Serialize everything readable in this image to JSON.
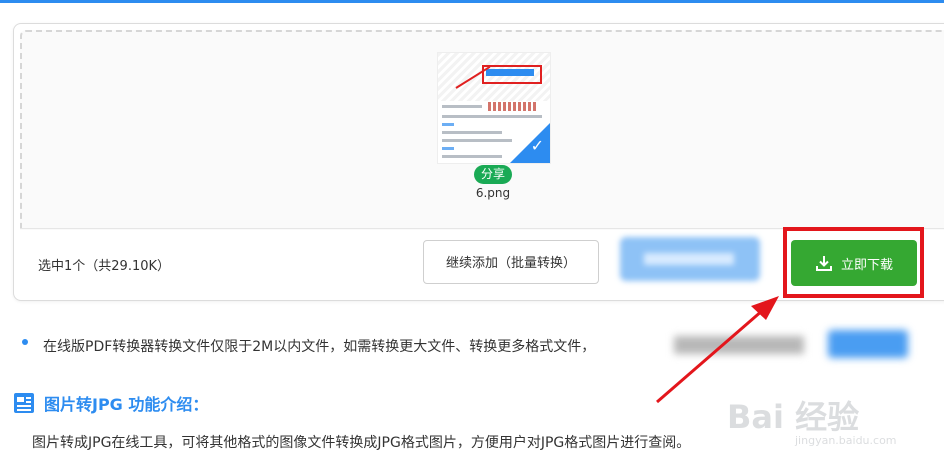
{
  "upload": {
    "file": {
      "share_label": "分享",
      "name": "6.png",
      "selected": true
    },
    "selection_summary": "选中1个（共29.10K）",
    "continue_button": "继续添加（批量转换）",
    "download_button": "立即下载"
  },
  "notice": {
    "text": "在线版PDF转换器转换文件仅限于2M以内文件，如需转换更大文件、转换更多格式文件，"
  },
  "section": {
    "title": "图片转JPG 功能介绍：",
    "description": "图片转成JPG在线工具，可将其他格式的图像文件转换成JPG格式图片，方便用户对JPG格式图片进行查阅。"
  },
  "watermark": {
    "brand": "Bai 经验",
    "url": "jingyan.baidu.com"
  },
  "colors": {
    "accent": "#2d8cf0",
    "download_green": "#35a832",
    "highlight_red": "#e3161c",
    "share_green": "#1aaa55"
  },
  "icons": {
    "download": "download-icon",
    "check": "check-icon",
    "section": "document-icon"
  }
}
